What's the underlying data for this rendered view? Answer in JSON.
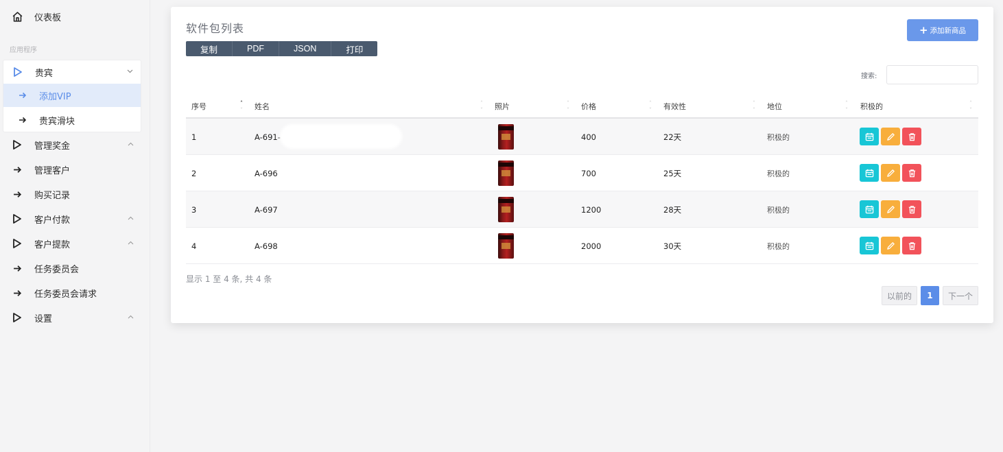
{
  "sidebar": {
    "dashboard": "仪表板",
    "section_label": "应用程序",
    "vip": "贵宾",
    "vip_sub": [
      "添加VIP",
      "贵宾滑块"
    ],
    "manage_bonus": "管理奖金",
    "manage_customers": "管理客户",
    "purchase_records": "购买记录",
    "customer_payments": "客户付款",
    "customer_withdrawals": "客户提款",
    "task_committee": "任务委员会",
    "task_committee_requests": "任务委员会请求",
    "settings": "设置"
  },
  "page": {
    "title": "软件包列表",
    "add_button": "添加新商品",
    "export_buttons": [
      "复制",
      "PDF",
      "JSON",
      "打印"
    ],
    "search_label": "搜索:",
    "search_value": ""
  },
  "table": {
    "headers": [
      "序号",
      "姓名",
      "照片",
      "价格",
      "有效性",
      "地位",
      "积极的"
    ],
    "rows": [
      {
        "no": "1",
        "name": "A-691-",
        "price": "400",
        "validity": "22天",
        "status": "积极的"
      },
      {
        "no": "2",
        "name": "A-696",
        "price": "700",
        "validity": "25天",
        "status": "积极的"
      },
      {
        "no": "3",
        "name": "A-697",
        "price": "1200",
        "validity": "28天",
        "status": "积极的"
      },
      {
        "no": "4",
        "name": "A-698",
        "price": "2000",
        "validity": "30天",
        "status": "积极的"
      }
    ],
    "info": "显示 1 至 4 条, 共 4 条"
  },
  "pagination": {
    "prev": "以前的",
    "current": "1",
    "next": "下一个"
  },
  "colors": {
    "primary": "#5b8de8",
    "view": "#18c6d6",
    "edit": "#f8ae3c",
    "delete": "#f2525a",
    "export_bg": "#4a5a6e"
  },
  "icons": [
    "home-icon",
    "play-outline-icon",
    "arrow-right-icon",
    "chevron-down-icon",
    "chevron-up-icon",
    "calendar-icon",
    "pencil-icon",
    "trash-icon",
    "plus-icon"
  ]
}
